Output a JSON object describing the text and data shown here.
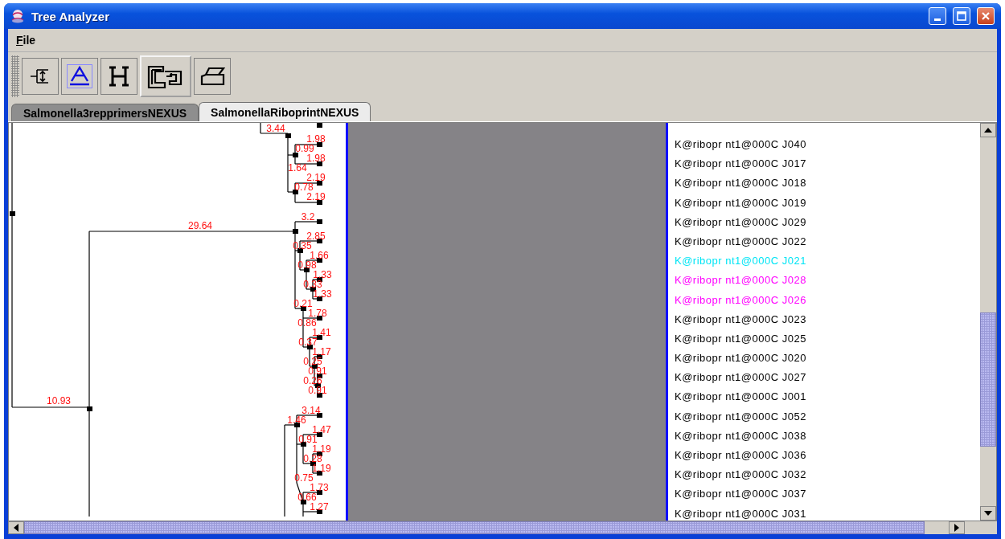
{
  "window": {
    "title": "Tree Analyzer"
  },
  "menu": [
    {
      "label": "File",
      "mnemonic": true
    }
  ],
  "toolbar": [
    {
      "kind": "resize",
      "selected": false,
      "raised": false
    },
    {
      "kind": "font",
      "selected": true,
      "raised": false
    },
    {
      "kind": "height",
      "selected": false,
      "raised": false
    },
    {
      "kind": "swap",
      "selected": false,
      "raised": true
    },
    {
      "kind": "print",
      "selected": false,
      "raised": false
    }
  ],
  "tabs": [
    {
      "label": "Salmonella3repprimersNEXUS",
      "selected": false
    },
    {
      "label": "SalmonellaRiboprintNEXUS",
      "selected": true
    }
  ],
  "branch_labels": [
    "3.44",
    "1.98",
    "0.99",
    "1.98",
    "1.64",
    "2.19",
    "0.78",
    "2.19",
    "3.2",
    "29.64",
    "2.85",
    "0.35",
    "1.66",
    "0.98",
    "1.33",
    "0.33",
    "1.33",
    "0.21",
    "1.78",
    "0.86",
    "1.41",
    "0.37",
    "1.17",
    "0.25",
    "0.91",
    "0.26",
    "0.91",
    "10.93",
    "3.14",
    "1.46",
    "1.47",
    "0.91",
    "1.19",
    "0.28",
    "1.19",
    "0.75",
    "1.73",
    "0.66",
    "1.27"
  ],
  "taxa": [
    {
      "label": "K@ribopr nt1@000C J040"
    },
    {
      "label": "K@ribopr nt1@000C J017"
    },
    {
      "label": "K@ribopr nt1@000C J018"
    },
    {
      "label": "K@ribopr nt1@000C J019"
    },
    {
      "label": "K@ribopr nt1@000C J029"
    },
    {
      "label": "K@ribopr nt1@000C J022"
    },
    {
      "label": "K@ribopr nt1@000C J021",
      "color": "#00e5f5"
    },
    {
      "label": "K@ribopr nt1@000C J028",
      "color": "#ff00ff"
    },
    {
      "label": "K@ribopr nt1@000C J026",
      "color": "#ff00ff"
    },
    {
      "label": "K@ribopr nt1@000C J023"
    },
    {
      "label": "K@ribopr nt1@000C J025"
    },
    {
      "label": "K@ribopr nt1@000C J020"
    },
    {
      "label": "K@ribopr nt1@000C J027"
    },
    {
      "label": "K@ribopr nt1@000C J001"
    },
    {
      "label": "K@ribopr nt1@000C J052"
    },
    {
      "label": "K@ribopr nt1@000C J038"
    },
    {
      "label": "K@ribopr nt1@000C J036"
    },
    {
      "label": "K@ribopr nt1@000C J032"
    },
    {
      "label": "K@ribopr nt1@000C J037"
    },
    {
      "label": "K@ribopr nt1@000C J031"
    }
  ]
}
